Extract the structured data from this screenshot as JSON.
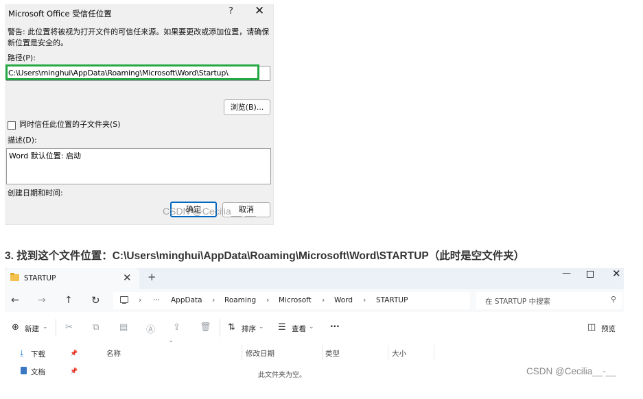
{
  "dialog": {
    "title": "Microsoft Office 受信任位置",
    "help_icon": "?",
    "close_icon": "✕",
    "warning": "警告: 此位置将被视为打开文件的可信任来源。如果要更改或添加位置，请确保新位置是安全的。",
    "path_label": "路径(P):",
    "path_value": "C:\\Users\\minghui\\AppData\\Roaming\\Microsoft\\Word\\Startup\\",
    "browse_label": "浏览(B)...",
    "subfolders_label": "同时信任此位置的子文件夹(S)",
    "subfolders_checked": false,
    "description_label": "描述(D):",
    "description_value": "Word 默认位置: 启动",
    "created_label": "创建日期和时间:",
    "ok_label": "确定",
    "cancel_label": "取消",
    "watermark": "CSDN @Cecilia__-__",
    "highlight_color": "#24a843"
  },
  "step_heading": "3. 找到这个文件位置：C:\\Users\\minghui\\AppData\\Roaming\\Microsoft\\Word\\STARTUP（此时是空文件夹）",
  "explorer": {
    "tab_title": "STARTUP",
    "tab_close": "✕",
    "tab_add": "+",
    "window_min": "—",
    "window_close": "✕",
    "nav": {
      "back": "←",
      "forward": "→",
      "up": "↑",
      "refresh": "↻",
      "more": "···"
    },
    "breadcrumbs": [
      "AppData",
      "Roaming",
      "Microsoft",
      "Word",
      "STARTUP"
    ],
    "breadcrumb_sep": "›",
    "search_placeholder": "在 STARTUP 中搜索",
    "toolbar": {
      "new_label": "新建",
      "sort_label": "排序",
      "view_label": "查看",
      "more_label": "···",
      "preview_label": "预览"
    },
    "sidebar": [
      {
        "label": "下载",
        "icon": "download-icon"
      },
      {
        "label": "文档",
        "icon": "documents-icon"
      }
    ],
    "columns": [
      "名称",
      "修改日期",
      "类型",
      "大小"
    ],
    "empty_message": "此文件夹为空。",
    "watermark": "CSDN @Cecilia__-__"
  }
}
